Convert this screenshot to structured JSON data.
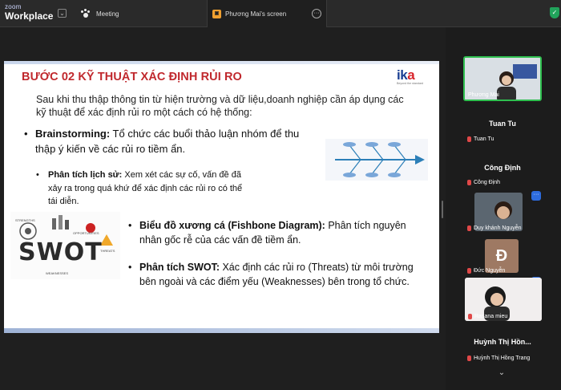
{
  "app": {
    "brand_top": "zoom",
    "brand_bottom": "Workplace"
  },
  "tabs": {
    "meeting_label": "Meeting",
    "screen_label": "Phương Mai's screen"
  },
  "slide": {
    "title": "BƯỚC 02 KỸ THUẬT XÁC ĐỊNH RỦI RO",
    "logo_text": "ika",
    "logo_tagline": "Beyond the standard",
    "intro": "Sau khi thu thập thông tin từ hiện trường và dữ liệu,doanh nghiệp cần áp dụng các kỹ thuật để xác định rủi ro một cách có hệ thống:",
    "bullets": [
      {
        "head": "Brainstorming:",
        "body": " Tổ chức các buổi thảo luận nhóm để thu thập ý kiến về các rủi ro tiềm ẩn."
      },
      {
        "head": "Phân tích lịch sử:",
        "body": " Xem xét các sự cố, vấn đề đã xảy ra trong quá khứ để xác định các rủi ro có thể tái diễn."
      },
      {
        "head": "Biểu đồ xương cá (Fishbone Diagram):",
        "body": " Phân tích nguyên nhân gốc rễ của các vấn đề tiềm ẩn."
      },
      {
        "head": "Phân tích SWOT:",
        "body": " Xác định các rủi ro (Threats) từ môi trường bên ngoài và các điểm yếu (Weaknesses) bên trong tổ chức."
      }
    ],
    "swot_image": {
      "word": "SWOT",
      "labels": [
        "STRENGTHS",
        "OPPORTUNITIES",
        "THREATS",
        "WEAKNESSES"
      ]
    }
  },
  "participants": [
    {
      "name": "Phương Mai",
      "muted": false,
      "active_speaker": true
    },
    {
      "name": "Tuan Tu",
      "display_name": "Tuan Tu",
      "muted": true
    },
    {
      "name": "Công Định",
      "display_name": "Công Định",
      "muted": true
    },
    {
      "name": "Duy khánh Nguyễn",
      "muted": true
    },
    {
      "name": "Đức Nguyễn",
      "avatar_letter": "Đ",
      "muted": true
    },
    {
      "name": "Rasana mieu",
      "muted": true
    },
    {
      "name": "Huỳnh Thị Hồng Trang",
      "display_name": "Huỳnh Thị Hồn...",
      "muted": true
    }
  ],
  "colors": {
    "title_red": "#c0282d",
    "logo_blue": "#1b3f93",
    "active_border": "#2fbf4f",
    "accent_blue": "#2d6cdf"
  },
  "icons": [
    "chevron-down-icon",
    "paw-icon",
    "screen-share-icon",
    "more-icon",
    "shield-check-icon",
    "mic-muted-icon"
  ]
}
